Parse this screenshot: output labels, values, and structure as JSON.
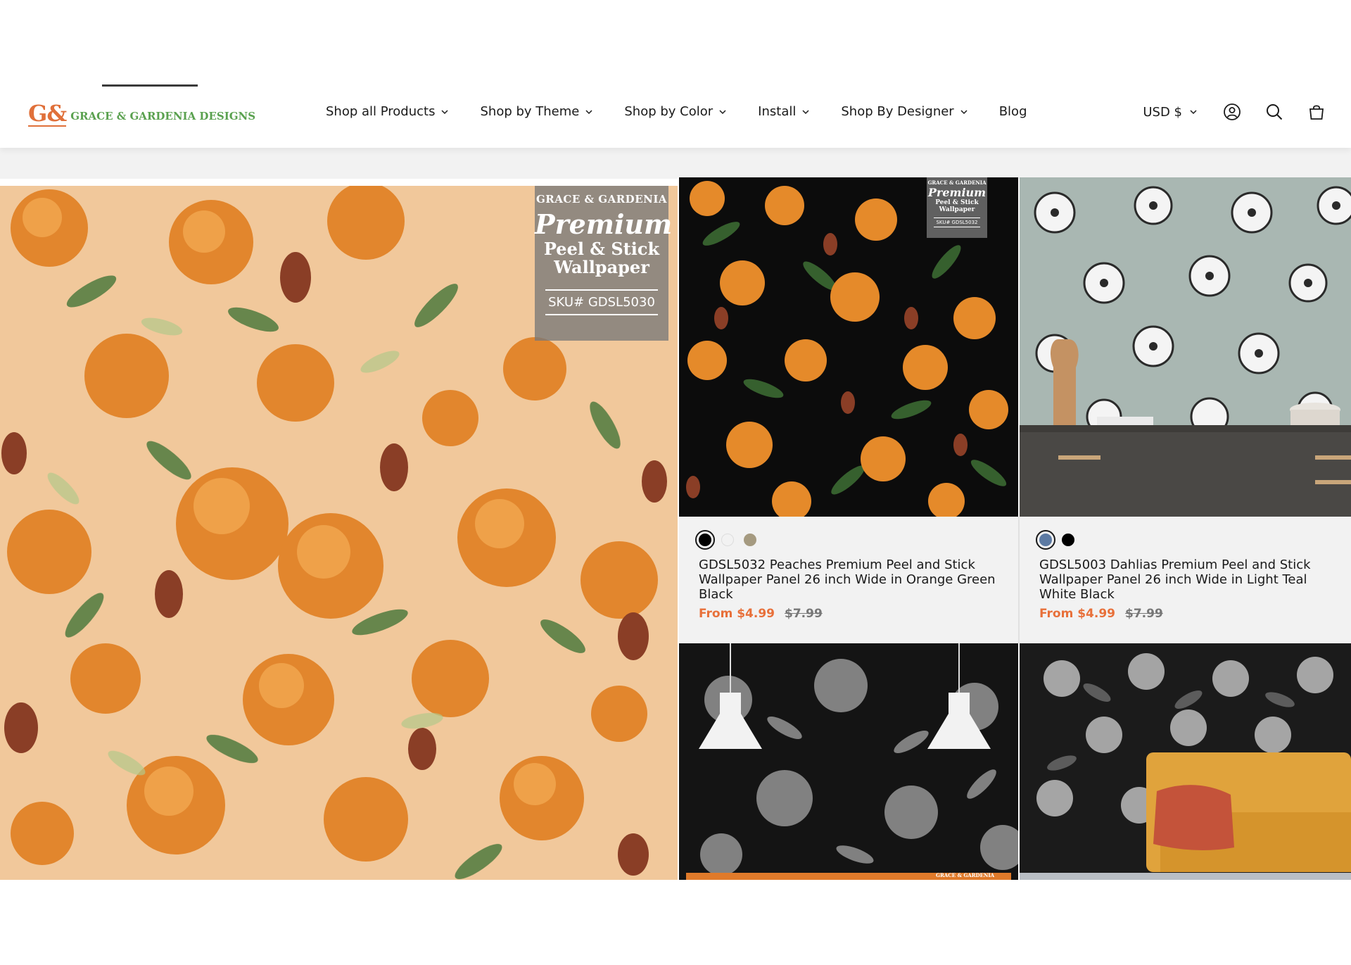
{
  "header": {
    "logo_mark": "G&",
    "logo_text": "GRACE & GARDENIA DESIGNS",
    "nav": [
      {
        "label": "Shop all Products"
      },
      {
        "label": "Shop by Theme"
      },
      {
        "label": "Shop by Color"
      },
      {
        "label": "Install"
      },
      {
        "label": "Shop By Designer"
      },
      {
        "label": "Blog"
      }
    ],
    "currency": "USD $"
  },
  "hero": {
    "badge_brand": "GRACE & GARDENIA",
    "badge_premium": "Premium",
    "badge_line1": "Peel & Stick",
    "badge_line2": "Wallpaper",
    "badge_sku": "SKU# GDSL5030"
  },
  "products": [
    {
      "title": "GDSL5032 Peaches Premium Peel and Stick Wallpaper Panel 26 inch Wide in Orange Green Black",
      "price_sale": "From $4.99",
      "price_old": "$7.99",
      "swatches": [
        "#000000",
        "#f2f2f2",
        "#a59a80"
      ],
      "badge_brand": "GRACE & GARDENIA",
      "badge_premium": "Premium",
      "badge_line1": "Peel & Stick",
      "badge_line2": "Wallpaper",
      "badge_sku": "SKU# GDSL5032"
    },
    {
      "title": "GDSL5003 Dahlias Premium Peel and Stick Wallpaper Panel 26 inch Wide in Light Teal White Black",
      "price_sale": "From $4.99",
      "price_old": "$7.99",
      "swatches": [
        "#5c7aa3",
        "#000000"
      ]
    }
  ],
  "bottom_strip_text": "GRACE & GARDENIA",
  "colors": {
    "accent": "#e8703a",
    "logo_green": "#5aa14f",
    "background_band": "#f2f2f2"
  }
}
